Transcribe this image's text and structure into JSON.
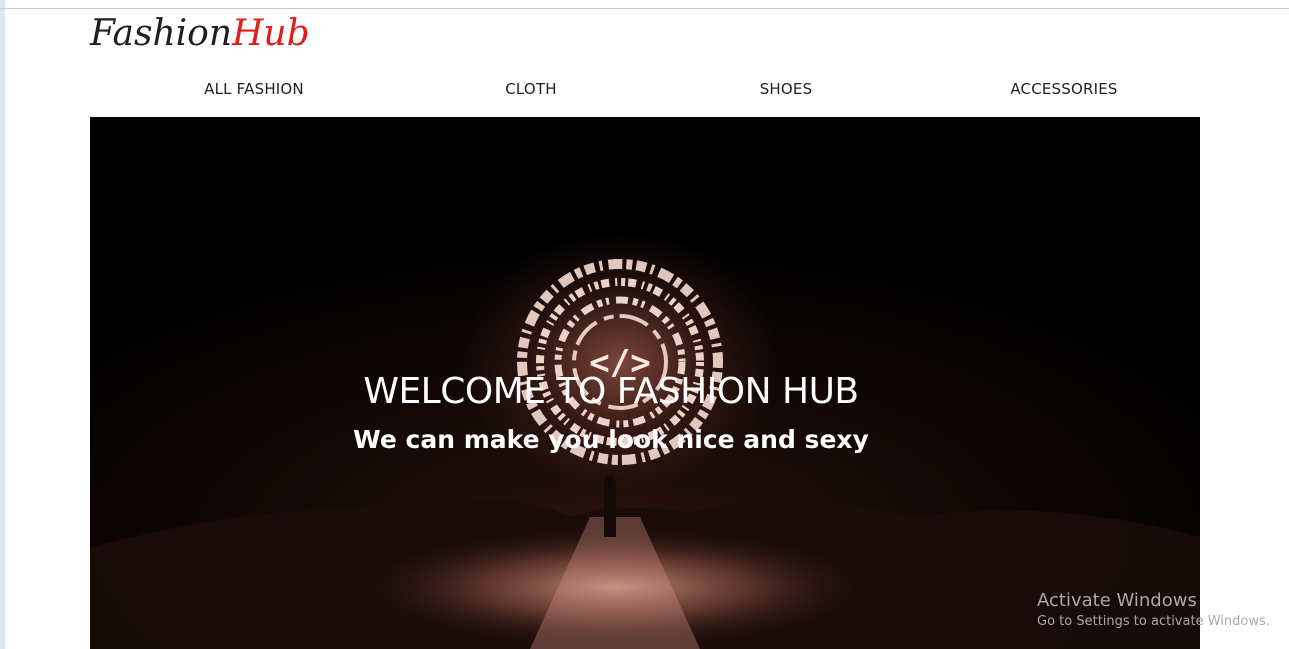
{
  "brand": {
    "part1": "Fashion",
    "part2": "Hub",
    "part1_color": "#1f1f1f",
    "part2_color": "#e11d1d"
  },
  "nav": {
    "items": [
      {
        "label": "ALL FASHION"
      },
      {
        "label": "CLOTH"
      },
      {
        "label": "SHOES"
      },
      {
        "label": "ACCESSORIES"
      }
    ]
  },
  "hero": {
    "title": "WELCOME TO FASHION HUB",
    "subtitle": "We can make you look nice and sexy",
    "code_glyph": "</>",
    "image_subject": "glowing code emblem above a figure on a reflective landscape",
    "glow_color": "#e8a08c"
  },
  "os_watermark": {
    "title": "Activate Windows",
    "subtitle": "Go to Settings to activate Windows."
  }
}
